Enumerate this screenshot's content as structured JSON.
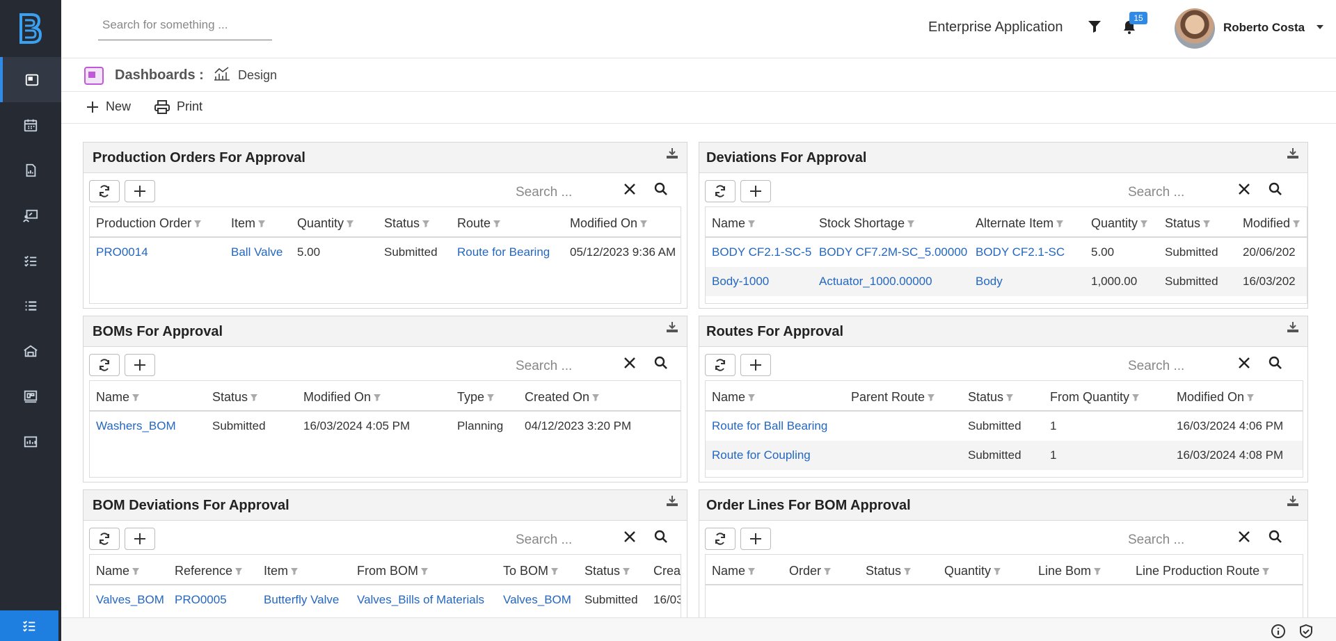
{
  "app": {
    "logo_text": "B",
    "name": "Enterprise Application"
  },
  "search": {
    "placeholder": "Search for something ..."
  },
  "notifications": {
    "count": "15"
  },
  "user": {
    "name": "Roberto Costa"
  },
  "breadcrumb": {
    "title": "Dashboards :",
    "view": "Design"
  },
  "toolbar": {
    "new_label": "New",
    "print_label": "Print"
  },
  "sidebar_icons": [
    "dashboard-icon",
    "calendar-icon",
    "report-icon",
    "presentation-icon",
    "checklist-icon",
    "list-icon",
    "warehouse-icon",
    "kanban-board-icon",
    "production-chart-icon"
  ],
  "panel_search_placeholder": "Search ...",
  "panels": {
    "production_orders": {
      "title": "Production Orders For Approval",
      "columns": [
        "Production Order",
        "Item",
        "Quantity",
        "Status",
        "Route",
        "Modified On"
      ],
      "rows": [
        [
          "PRO0014",
          "Ball Valve",
          "5.00",
          "Submitted",
          "Route for Bearing",
          "05/12/2023 9:36 AM"
        ]
      ]
    },
    "deviations": {
      "title": "Deviations For Approval",
      "columns": [
        "Name",
        "Stock Shortage",
        "Alternate Item",
        "Quantity",
        "Status",
        "Modified"
      ],
      "rows": [
        [
          "BODY CF2.1-SC-5",
          "BODY CF7.2M-SC_5.00000",
          "BODY CF2.1-SC",
          "5.00",
          "Submitted",
          "20/06/202"
        ],
        [
          "Body-1000",
          "Actuator_1000.00000",
          "Body",
          "1,000.00",
          "Submitted",
          "16/03/202"
        ]
      ]
    },
    "boms": {
      "title": "BOMs For Approval",
      "columns": [
        "Name",
        "Status",
        "Modified On",
        "Type",
        "Created On"
      ],
      "rows": [
        [
          "Washers_BOM",
          "Submitted",
          "16/03/2024 4:05 PM",
          "Planning",
          "04/12/2023 3:20 PM"
        ]
      ]
    },
    "routes": {
      "title": "Routes For Approval",
      "columns": [
        "Name",
        "Parent Route",
        "Status",
        "From Quantity",
        "Modified On"
      ],
      "rows": [
        [
          "Route for Ball Bearing",
          "",
          "Submitted",
          "1",
          "16/03/2024 4:06 PM"
        ],
        [
          "Route for Coupling",
          "",
          "Submitted",
          "1",
          "16/03/2024 4:08 PM"
        ]
      ]
    },
    "bom_deviations": {
      "title": "BOM Deviations For Approval",
      "columns": [
        "Name",
        "Reference",
        "Item",
        "From BOM",
        "To BOM",
        "Status",
        "Create"
      ],
      "rows": [
        [
          "Valves_BOM",
          "PRO0005",
          "Butterfly Valve",
          "Valves_Bills of Materials",
          "Valves_BOM",
          "Submitted",
          "16/03"
        ]
      ]
    },
    "order_lines": {
      "title": "Order Lines For BOM Approval",
      "columns": [
        "Name",
        "Order",
        "Status",
        "Quantity",
        "Line Bom",
        "Line Production Route"
      ],
      "rows": []
    }
  }
}
